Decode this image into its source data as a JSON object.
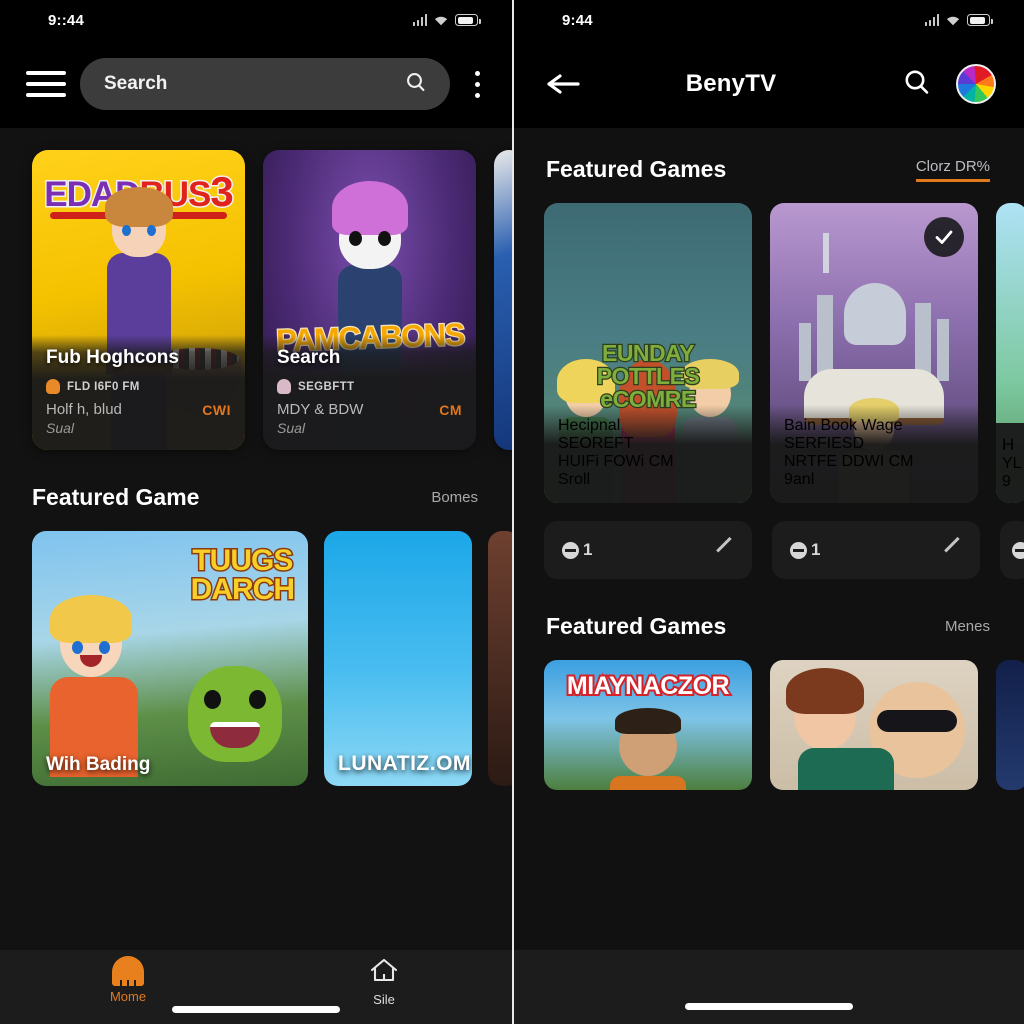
{
  "left": {
    "status_bar": {
      "time": "9::44",
      "icons": [
        "signal-icon",
        "wifi-icon",
        "battery-icon"
      ]
    },
    "app_bar": {
      "menu_icon": "hamburger-menu-icon",
      "search_placeholder": "Search",
      "search_icon": "search-icon",
      "overflow_icon": "kebab-menu-icon"
    },
    "hero_cards": [
      {
        "logo_a": "EDAD",
        "logo_b": "BUS",
        "logo_c": "3",
        "title": "Fub Hoghcons",
        "publisher": "FLD I6F0 FM",
        "desc": "Holf h, blud",
        "tag": "CWI",
        "sub": "Sual"
      },
      {
        "logo": "PAMCABONS",
        "title": "Search",
        "publisher": "SEGBFTT",
        "desc": "MDY & BDW",
        "tag": "CM",
        "sub": "Sual"
      }
    ],
    "section": {
      "title": "Featured Game",
      "link": "Bomes"
    },
    "thumbs": [
      {
        "logo_line1": "TUUGS",
        "logo_line2": "DARCH",
        "caption": "Wih Bading"
      },
      {
        "caption": "LUNATIZ.OM"
      }
    ],
    "bottom_nav": [
      {
        "label": "Mome",
        "icon": "ghost-icon",
        "active": true
      },
      {
        "label": "Sile",
        "icon": "home-icon",
        "active": false
      }
    ]
  },
  "right": {
    "status_bar": {
      "time": "9:44",
      "icons": [
        "signal-icon",
        "wifi-icon",
        "battery-icon"
      ]
    },
    "app_bar": {
      "back_icon": "back-arrow-icon",
      "title": "BenyTV",
      "search_icon": "search-icon",
      "avatar": "profile-avatar"
    },
    "section_one": {
      "title": "Featured Games",
      "link": "Clorz DR%"
    },
    "hero_cards": [
      {
        "logo_line1": "EUNDAY",
        "logo_line2": "POTTLES",
        "logo_line3": "eCOMRE",
        "title": "Hecipnal",
        "publisher": "SEOREFT",
        "desc": "HUIFi FOWi",
        "tag": "CM",
        "sub": "Sroll",
        "badge": null
      },
      {
        "title": "Bain Book Wage",
        "publisher": "SERFIESD",
        "desc": "NRTFE DDWI",
        "tag": "CM",
        "sub": "9anl",
        "badge": "check-icon"
      },
      {
        "title": "H",
        "publisher": "",
        "desc": "YL",
        "tag": "",
        "sub": "9"
      }
    ],
    "pills": [
      {
        "value": "1",
        "coin_icon": "coin-icon",
        "action_icon": "slash-icon"
      },
      {
        "value": "1",
        "coin_icon": "coin-icon",
        "action_icon": "slash-icon"
      },
      {
        "value": "",
        "coin_icon": "coin-icon",
        "action_icon": "slash-icon"
      }
    ],
    "section_two": {
      "title": "Featured Games",
      "link": "Menes"
    },
    "thumbs": [
      {
        "logo": "MIAYNACZOR"
      },
      {
        "logo": ""
      },
      {
        "logo": ""
      }
    ]
  },
  "colors": {
    "accent_orange": "#e07a1d",
    "background": "#121212",
    "card_background": "#1b1b1b",
    "text_primary": "#ffffff",
    "text_secondary": "#b9b9b9"
  }
}
